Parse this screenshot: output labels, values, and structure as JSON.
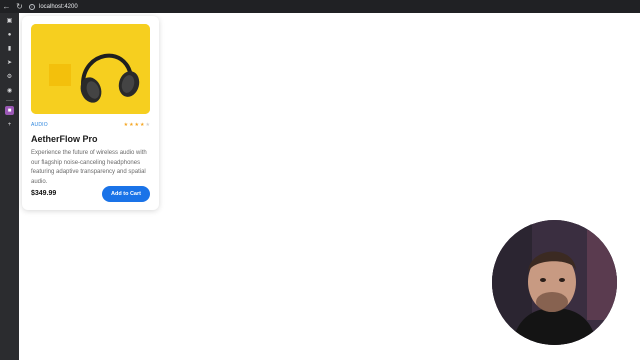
{
  "browser": {
    "url": "localhost:4200"
  },
  "sidebar": {
    "icons": [
      "tab-icon",
      "circle-icon",
      "bookmark-icon",
      "cursor-icon",
      "extension-icon",
      "github-icon",
      "purple-app-icon",
      "plus-icon"
    ]
  },
  "product": {
    "category": "AUDIO",
    "rating": 4,
    "rating_max": 5,
    "title": "AetherFlow Pro",
    "description": "Experience the future of wireless audio with our flagship noise-canceling headphones featuring adaptive transparency and spatial audio.",
    "price": "$349.99",
    "cta_label": "Add to Cart"
  },
  "colors": {
    "accent": "#1a73e8",
    "category": "#2e86de",
    "star": "#f5a623",
    "image_bg": "#f6cf1f"
  }
}
